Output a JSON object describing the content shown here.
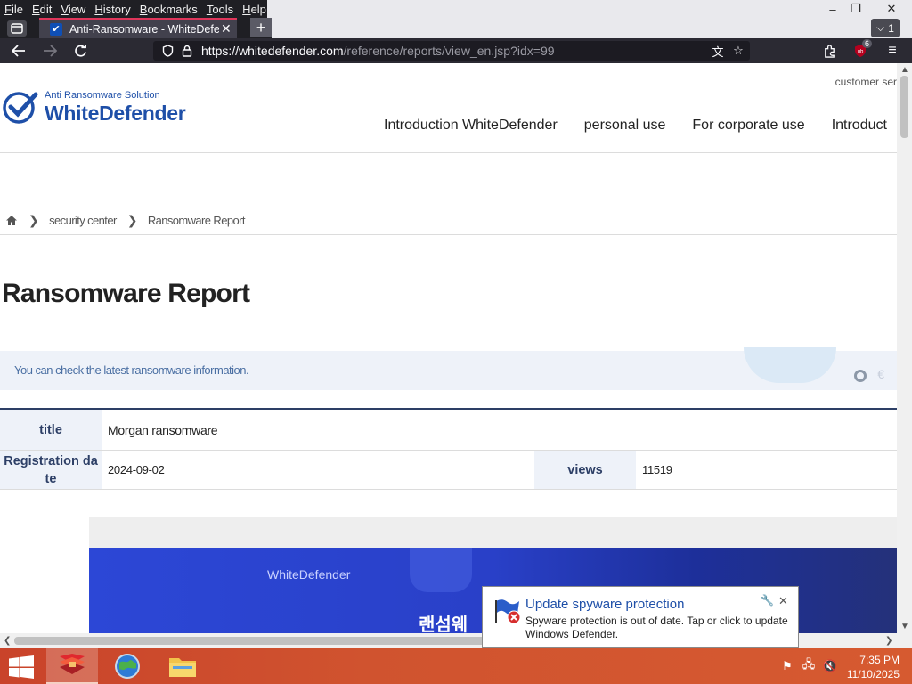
{
  "menubar": {
    "items": [
      "File",
      "Edit",
      "View",
      "History",
      "Bookmarks",
      "Tools",
      "Help"
    ]
  },
  "window": {
    "minimize": "–",
    "restore": "❐",
    "close": "✕"
  },
  "tabbar": {
    "active_tab_title": "Anti-Ransomware - WhiteDefen",
    "close_glyph": "✕",
    "new_tab_glyph": "+",
    "tab_count": "1"
  },
  "navbar": {
    "url_host": "https://whitedefender.com",
    "url_path": "/reference/reports/view_en.jsp?idx=99",
    "extension_badge": "6"
  },
  "site": {
    "logo_tagline": "Anti Ransomware Solution",
    "logo_name": "WhiteDefender",
    "customer_link": "customer ser",
    "nav": [
      "Introduction WhiteDefender",
      "personal use",
      "For corporate use",
      "Introduct"
    ]
  },
  "breadcrumb": {
    "items": [
      "security center",
      "Ransomware Report"
    ]
  },
  "report": {
    "page_title": "Ransomware Report",
    "info_text": "You can check the latest ransomware information.",
    "title_label": "title",
    "title_value": "Morgan ransomware",
    "date_label": "Registration da te",
    "date_value": "2024-09-02",
    "views_label": "views",
    "views_value": "11519",
    "image_brand": "WhiteDefender",
    "image_korean": "랜섬웨"
  },
  "notification": {
    "title": "Update spyware protection",
    "body": "Spyware protection is out of date. Tap or click to update Windows Defender."
  },
  "taskbar": {
    "time": "7:35 PM",
    "date": "11/10/2025"
  },
  "colors": {
    "brand_blue": "#1e4fa8",
    "table_header_text": "#2d3f66",
    "table_header_bg": "#eef2f9",
    "tab_accent": "#e0365b",
    "taskbar": "#d0532f"
  }
}
